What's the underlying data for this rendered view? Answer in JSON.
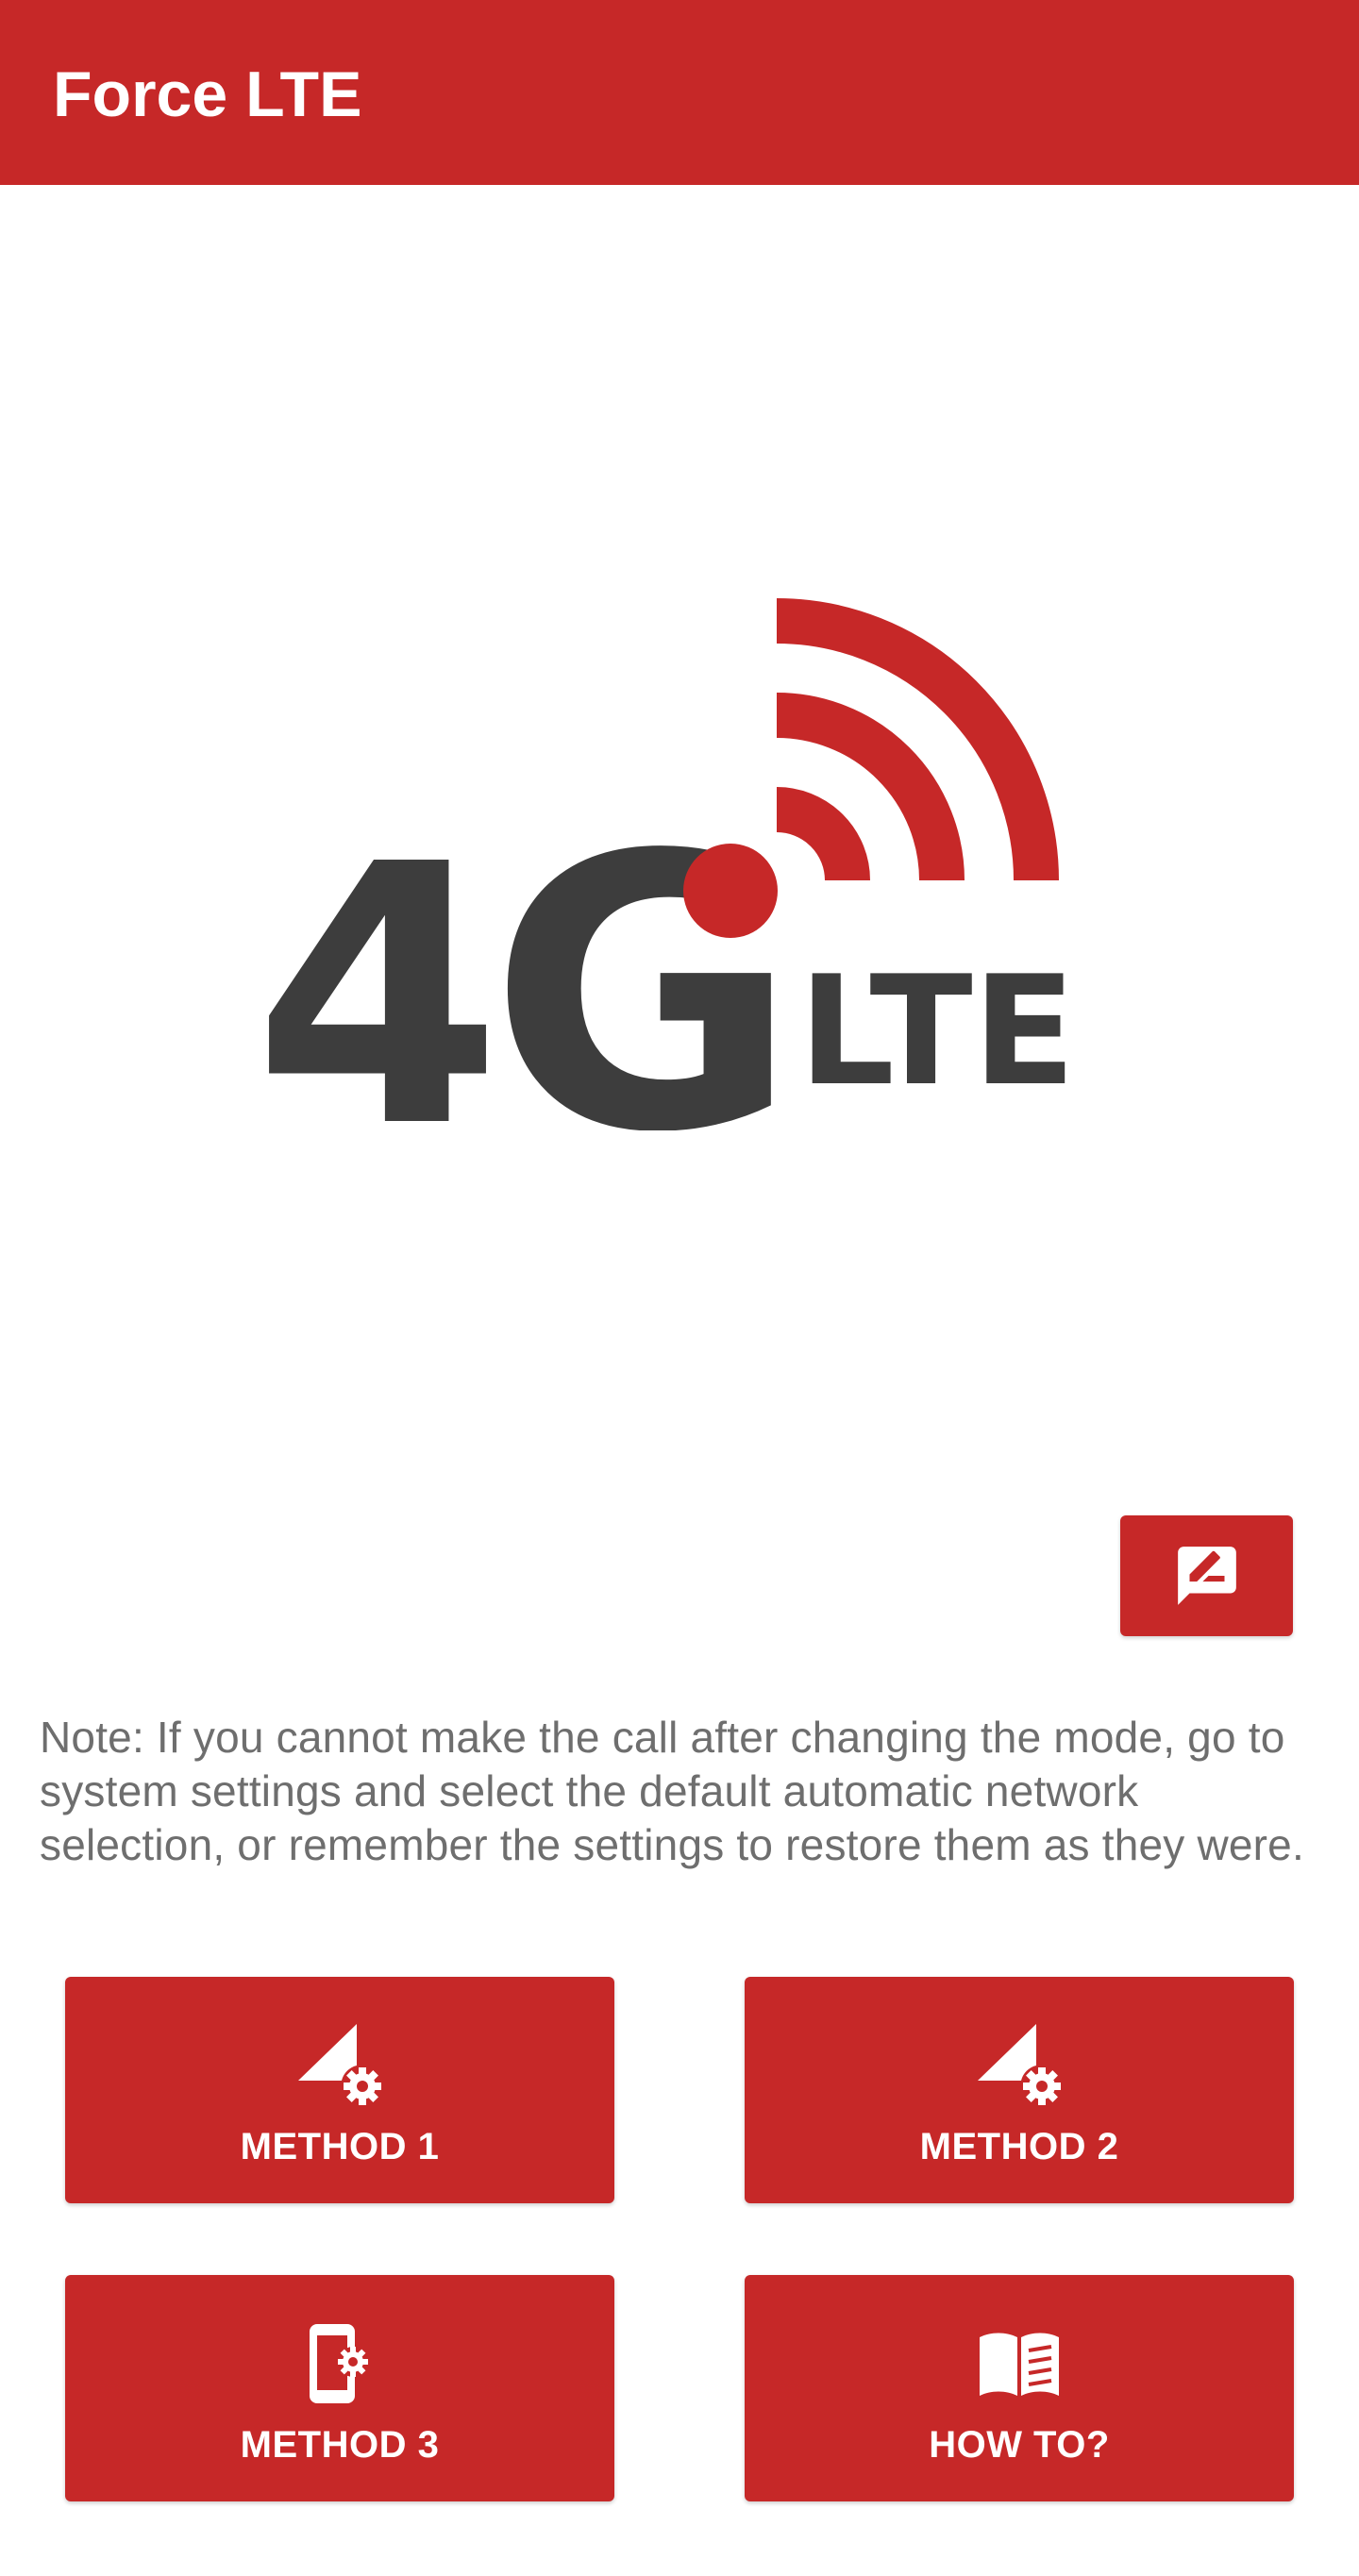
{
  "app": {
    "title": "Force LTE",
    "accent_color": "#c62828"
  },
  "logo": {
    "text_4g": "4G",
    "text_lte": "LTE",
    "icon": "4g-lte-signal-logo",
    "colors": {
      "text": "#3d3d3d",
      "signal": "#c62828"
    }
  },
  "feedback": {
    "icon": "rate-review-icon"
  },
  "note": {
    "text": "Note: If you cannot make the call after changing the mode, go to system settings and select the default automatic network selection, or remember the settings to restore them as they were."
  },
  "buttons": [
    {
      "label": "METHOD 1",
      "icon": "network-settings-icon"
    },
    {
      "label": "METHOD 2",
      "icon": "network-settings-icon"
    },
    {
      "label": "METHOD 3",
      "icon": "phone-settings-icon"
    },
    {
      "label": "HOW TO?",
      "icon": "book-icon"
    }
  ]
}
